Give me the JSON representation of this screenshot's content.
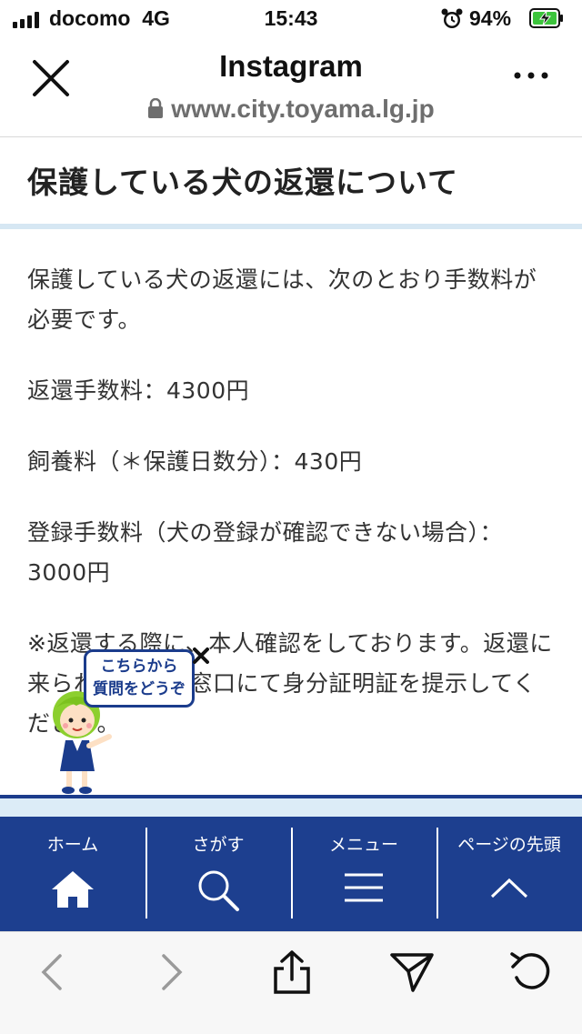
{
  "status_bar": {
    "carrier": "docomo",
    "network": "4G",
    "time": "15:43",
    "battery": "94%",
    "alarm_icon": "alarm-clock-icon",
    "battery_icon": "battery-charging-icon"
  },
  "header": {
    "title": "Instagram",
    "url": "www.city.toyama.lg.jp",
    "close_icon": "close-icon",
    "more_icon": "more-icon"
  },
  "page": {
    "title": "保護している犬の返還について",
    "paragraphs": [
      "保護している犬の返還には、次のとおり手数料が必要です。",
      "返還手数料：4300円",
      "飼養料（＊保護日数分）：430円",
      "登録手数料（犬の登録が確認できない場合）：3000円",
      "※返還する際に、本人確認をしております。返還に来られる方は、窓口にて身分証明証を提示してください。"
    ]
  },
  "chatbot": {
    "bubble_line1": "こちらから",
    "bubble_line2": "質問をどうぞ"
  },
  "site_nav": {
    "items": [
      {
        "label": "ホーム",
        "icon": "home-icon"
      },
      {
        "label": "さがす",
        "icon": "search-icon"
      },
      {
        "label": "メニュー",
        "icon": "menu-icon"
      },
      {
        "label": "ページの先頭",
        "icon": "chevron-up-icon"
      }
    ]
  },
  "toolbar": {
    "icons": [
      "back-icon",
      "forward-icon",
      "share-icon",
      "send-icon",
      "reload-icon"
    ]
  },
  "colors": {
    "nav_bg": "#1d3f8f",
    "accent_light": "#d6e7f3",
    "battery_green": "#3cc43c"
  }
}
